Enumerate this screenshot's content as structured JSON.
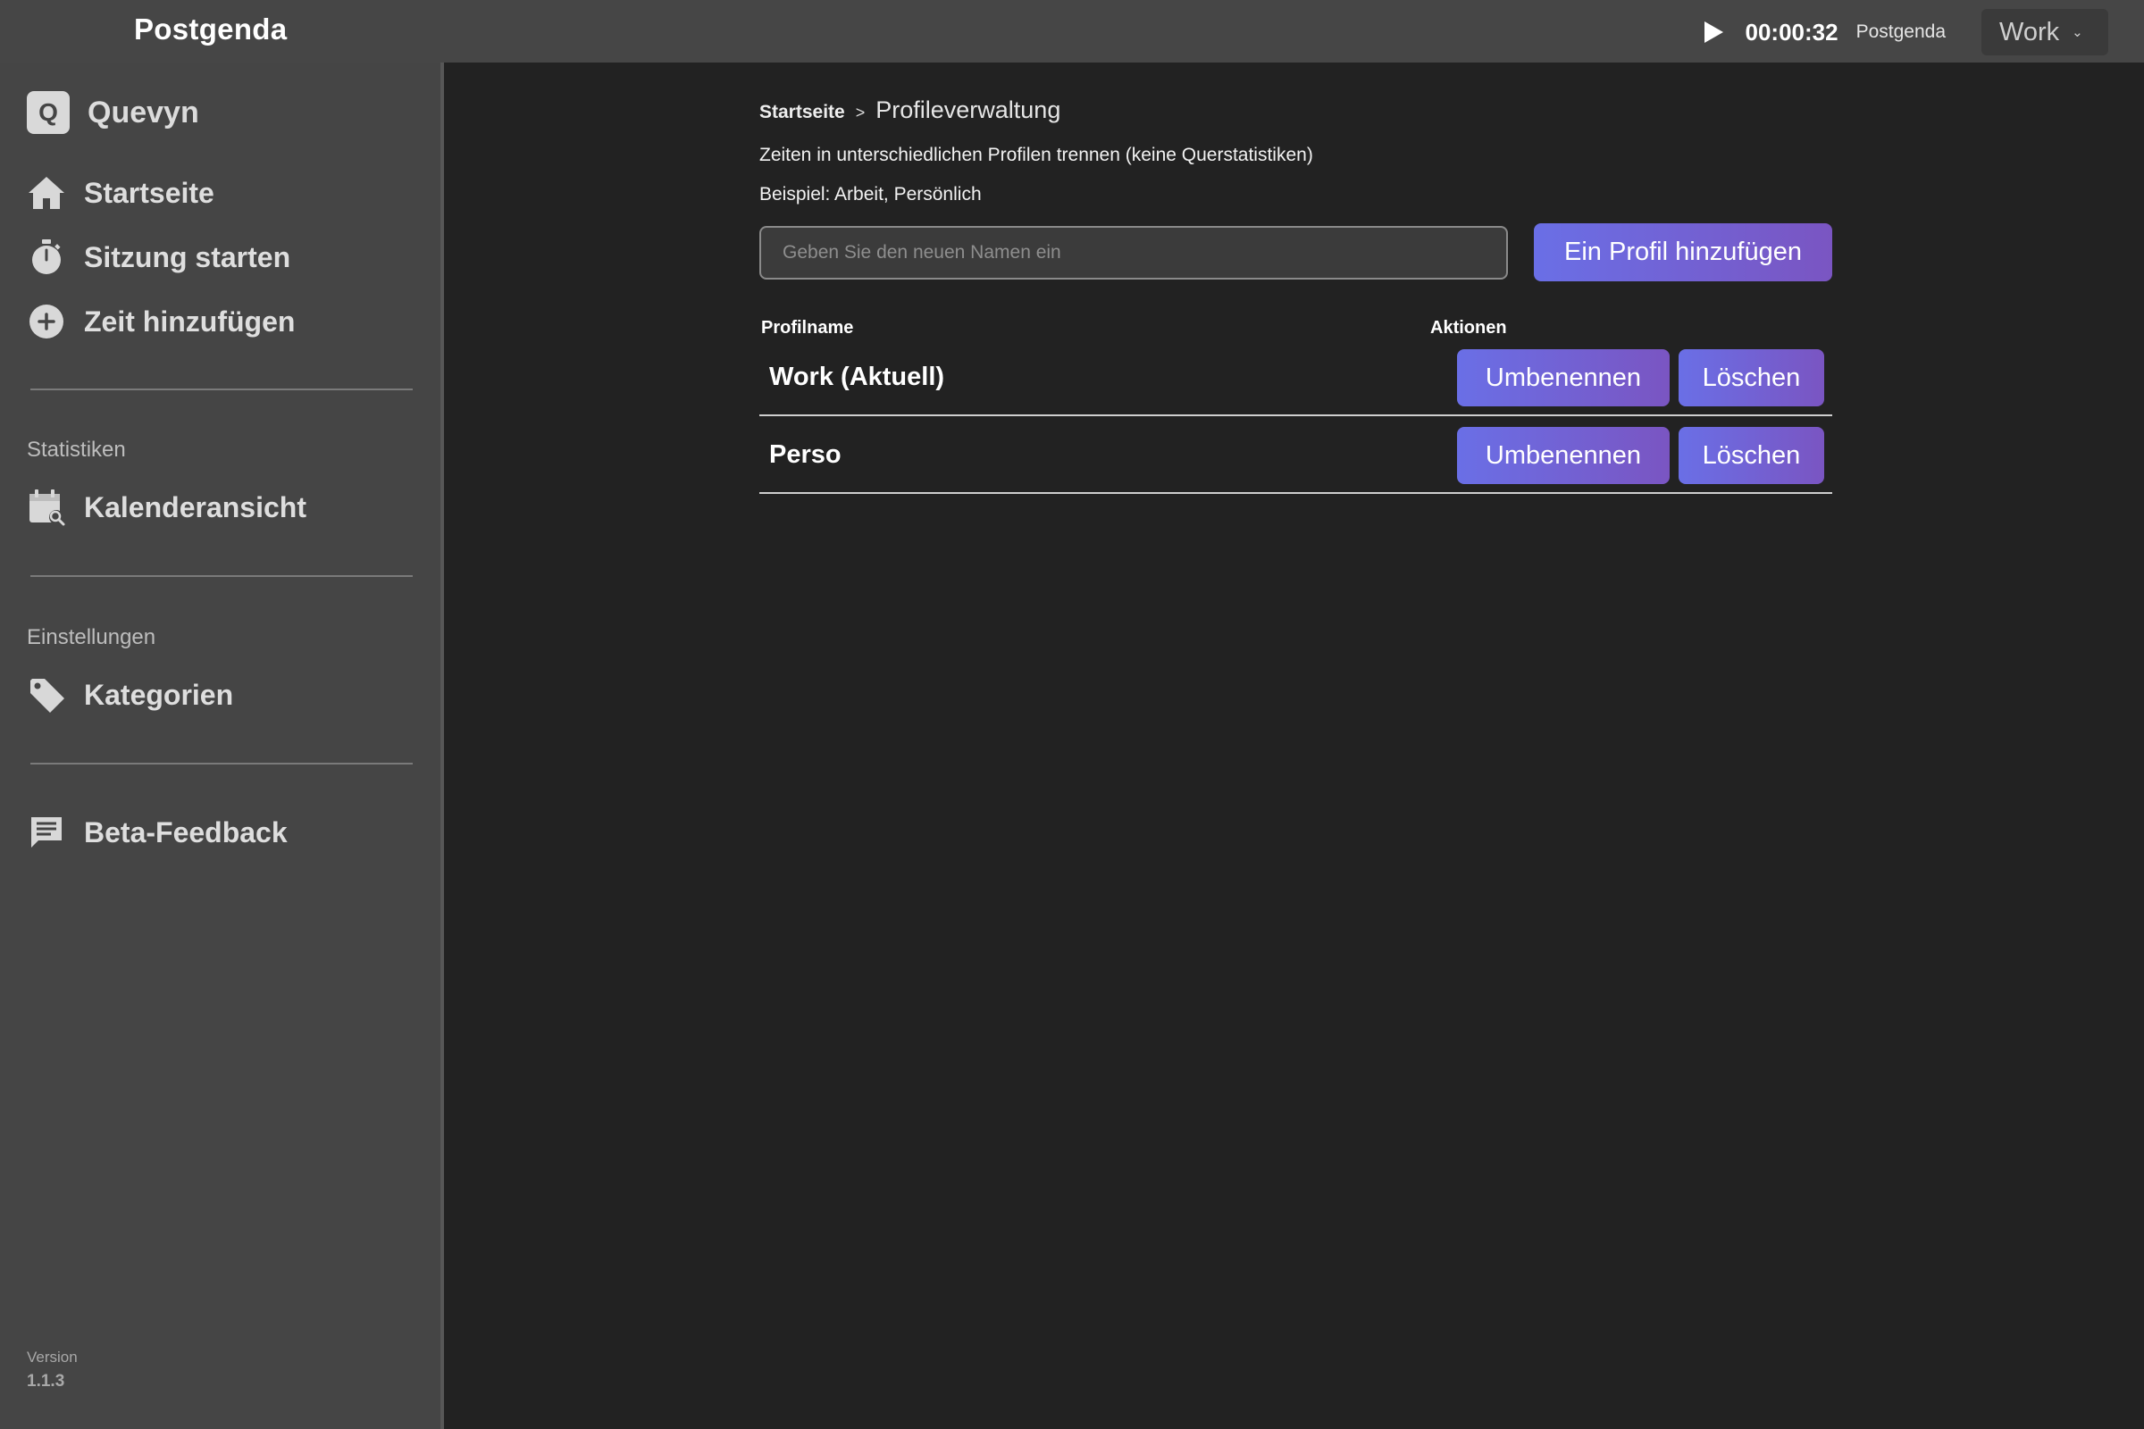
{
  "topbar": {
    "app_title": "Postgenda",
    "timer": "00:00:32",
    "timer_project": "Postgenda",
    "profile_select_value": "Work",
    "play_icon": "play-icon",
    "chevron_icon": "chevron-down-icon"
  },
  "sidebar": {
    "brand_logo_letter": "Q",
    "brand_name": "Quevyn",
    "main_items": [
      {
        "label": "Startseite",
        "icon": "home-icon"
      },
      {
        "label": "Sitzung starten",
        "icon": "stopwatch-icon"
      },
      {
        "label": "Zeit hinzufügen",
        "icon": "plus-circle-icon"
      }
    ],
    "stats_section": {
      "label": "Statistiken",
      "items": [
        {
          "label": "Kalenderansicht",
          "icon": "calendar-search-icon"
        }
      ]
    },
    "settings_section": {
      "label": "Einstellungen",
      "items": [
        {
          "label": "Kategorien",
          "icon": "tag-icon"
        }
      ]
    },
    "feedback_item": {
      "label": "Beta-Feedback",
      "icon": "feedback-icon"
    },
    "version_label": "Version",
    "version_number": "1.1.3"
  },
  "main": {
    "breadcrumb": {
      "home": "Startseite",
      "separator": ">",
      "current": "Profileverwaltung"
    },
    "description": "Zeiten in unterschiedlichen Profilen trennen (keine Querstatistiken)",
    "example": "Beispiel: Arbeit, Persönlich",
    "new_profile_input": {
      "placeholder": "Geben Sie den neuen Namen ein",
      "value": ""
    },
    "add_button_label": "Ein Profil hinzufügen",
    "table": {
      "headers": [
        "Profilname",
        "Aktionen"
      ],
      "rows": [
        {
          "name": "Work (Aktuell)",
          "rename_label": "Umbenennen",
          "delete_label": "Löschen"
        },
        {
          "name": "Perso",
          "rename_label": "Umbenennen",
          "delete_label": "Löschen"
        }
      ]
    },
    "accent_gradient": [
      "#6a6fe6",
      "#7a55c2"
    ]
  }
}
